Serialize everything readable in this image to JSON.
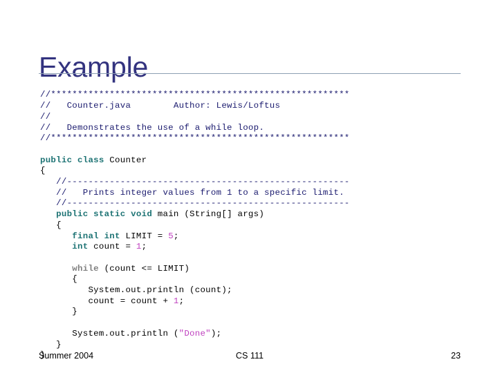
{
  "slide": {
    "title": "Example",
    "title_color": "#33337f",
    "rule_color": "#8d9fb3",
    "background_color": "#ffffff"
  },
  "colors": {
    "comment": "#1a1a6e",
    "keyword": "#1d7374",
    "keyword_dim": "#808080",
    "literal": "#bf40bf",
    "string": "#bf40bf",
    "plain": "#000000"
  },
  "code": {
    "language": "java",
    "file_name": "Counter.java",
    "author": "Lewis/Loftus",
    "description": "Demonstrates the use of a while loop.",
    "lines": [
      {
        "id": "l01",
        "text": "//********************************************************"
      },
      {
        "id": "l02",
        "text": "//   Counter.java        Author: Lewis/Loftus"
      },
      {
        "id": "l03",
        "text": "//"
      },
      {
        "id": "l04",
        "text": "//   Demonstrates the use of a while loop."
      },
      {
        "id": "l05",
        "text": "//********************************************************"
      },
      {
        "id": "l06",
        "text": ""
      },
      {
        "id": "l07",
        "text": "public class Counter"
      },
      {
        "id": "l08",
        "text": "{"
      },
      {
        "id": "l09",
        "text": "   //-----------------------------------------------------"
      },
      {
        "id": "l10",
        "text": "   //   Prints integer values from 1 to a specific limit."
      },
      {
        "id": "l11",
        "text": "   //-----------------------------------------------------"
      },
      {
        "id": "l12",
        "text": "   public static void main (String[] args)"
      },
      {
        "id": "l13",
        "text": "   {"
      },
      {
        "id": "l14",
        "text": "      final int LIMIT = 5;"
      },
      {
        "id": "l15",
        "text": "      int count = 1;"
      },
      {
        "id": "l16",
        "text": ""
      },
      {
        "id": "l17",
        "text": "      while (count <= LIMIT)"
      },
      {
        "id": "l18",
        "text": "      {"
      },
      {
        "id": "l19",
        "text": "         System.out.println (count);"
      },
      {
        "id": "l20",
        "text": "         count = count + 1;"
      },
      {
        "id": "l21",
        "text": "      }"
      },
      {
        "id": "l22",
        "text": ""
      },
      {
        "id": "l23",
        "text": "      System.out.println (\"Done\");"
      },
      {
        "id": "l24",
        "text": "   }"
      },
      {
        "id": "l25",
        "text": "}"
      }
    ]
  },
  "footer": {
    "left": "Summer 2004",
    "center": "CS 111",
    "right": "23"
  }
}
